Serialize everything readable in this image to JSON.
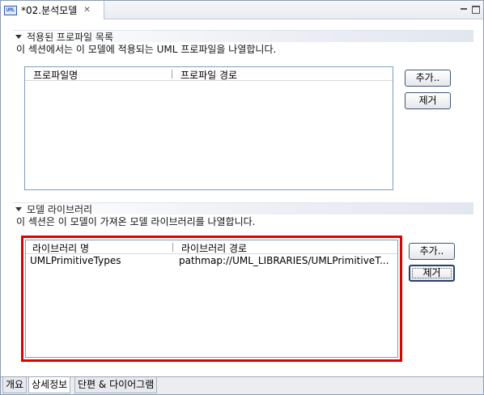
{
  "editor": {
    "tab_title": "*02.분석모델",
    "icon_label": "UML"
  },
  "profiles_section": {
    "title": "적용된 프로파일 목록",
    "description": "이 섹션에서는 이 모델에 적용되는 UML 프로파일을 나열합니다.",
    "columns": [
      "프로파일명",
      "프로파일 경로"
    ],
    "rows": [],
    "add_label": "추가..",
    "remove_label": "제거"
  },
  "libraries_section": {
    "title": "모델 라이브러리",
    "description": "이 섹션은 이 모델이 가져온 모델 라이브러리를 나열합니다.",
    "columns": [
      "라이브러리 명",
      "라이브러리 경로"
    ],
    "rows": [
      {
        "name": "UMLPrimitiveTypes",
        "path": "pathmap://UML_LIBRARIES/UMLPrimitiveT..."
      }
    ],
    "add_label": "추가..",
    "remove_label": "제거"
  },
  "page_tabs": [
    {
      "label": "개요",
      "active": false
    },
    {
      "label": "상세정보",
      "active": true
    },
    {
      "label": "단편 & 다이어그램",
      "active": false
    }
  ],
  "colors": {
    "highlight": "#e00000",
    "border": "#7f9db9"
  }
}
